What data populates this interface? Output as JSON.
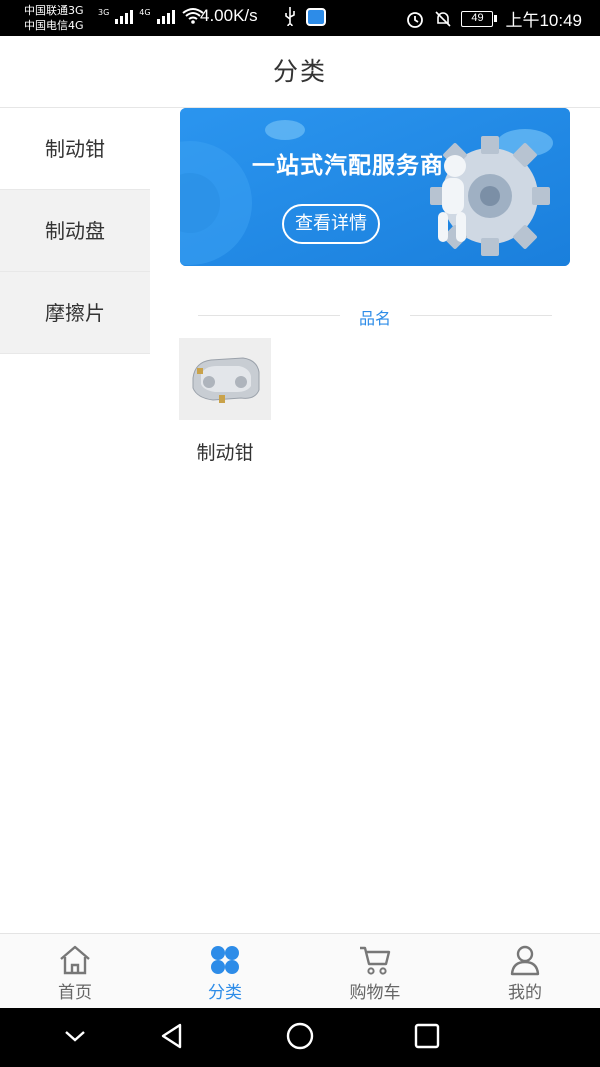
{
  "status_bar": {
    "carrier_1": "中国联通3G",
    "carrier_2": "中国电信4G",
    "net_3g": "3G",
    "net_4g": "4G",
    "speed": "4.00K/s",
    "battery": "49",
    "time": "上午10:49"
  },
  "header": {
    "title": "分类"
  },
  "sidebar": {
    "items": [
      {
        "label": "制动钳"
      },
      {
        "label": "制动盘"
      },
      {
        "label": "摩擦片"
      }
    ],
    "active_index": 0
  },
  "banner": {
    "title": "一站式汽配服务商",
    "button_label": "查看详情"
  },
  "section": {
    "label": "品名"
  },
  "products": [
    {
      "name": "制动钳",
      "image": "brake-caliper-image"
    }
  ],
  "tabbar": {
    "items": [
      {
        "label": "首页",
        "icon": "home-icon"
      },
      {
        "label": "分类",
        "icon": "category-icon"
      },
      {
        "label": "购物车",
        "icon": "cart-icon"
      },
      {
        "label": "我的",
        "icon": "user-icon"
      }
    ],
    "active_index": 1
  },
  "colors": {
    "accent": "#2d8ce8",
    "banner_bg": "#1e88e5",
    "sidebar_bg": "#f2f2f2"
  }
}
